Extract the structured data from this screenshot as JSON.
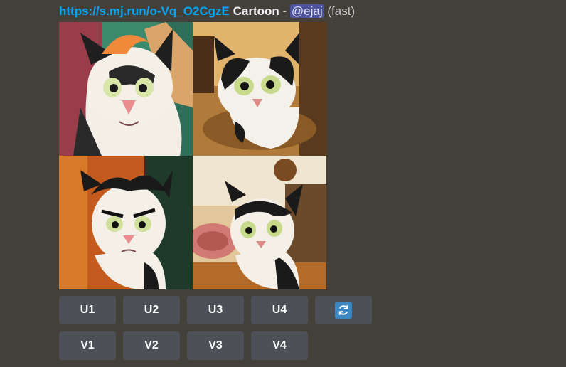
{
  "message": {
    "link_text": "https://s.mj.run/o-Vq_O2CgzE",
    "prompt": "Cartoon",
    "separator": " - ",
    "mention": "@ejaj",
    "speed": "(fast)"
  },
  "images": [
    {
      "icon": "cat-image-1"
    },
    {
      "icon": "cat-image-2"
    },
    {
      "icon": "cat-image-3"
    },
    {
      "icon": "cat-image-4"
    }
  ],
  "upscale_buttons": [
    "U1",
    "U2",
    "U3",
    "U4"
  ],
  "variation_buttons": [
    "V1",
    "V2",
    "V3",
    "V4"
  ],
  "refresh_button": {
    "icon": "refresh-icon"
  },
  "colors": {
    "background": "#433f39",
    "link": "#00a8fc",
    "button": "#4e5058",
    "refresh": "#3b88c3"
  }
}
